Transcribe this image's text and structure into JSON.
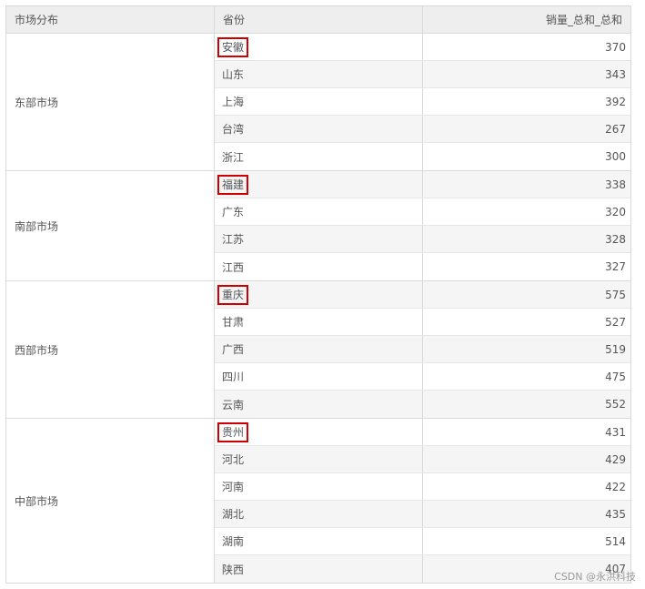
{
  "table": {
    "headers": [
      "市场分布",
      "省份",
      "销量_总和_总和"
    ],
    "groups": [
      {
        "market": "东部市场",
        "rows": [
          {
            "province": "安徽",
            "value": "370",
            "highlighted": true
          },
          {
            "province": "山东",
            "value": "343",
            "highlighted": false
          },
          {
            "province": "上海",
            "value": "392",
            "highlighted": false
          },
          {
            "province": "台湾",
            "value": "267",
            "highlighted": false
          },
          {
            "province": "浙江",
            "value": "300",
            "highlighted": false
          }
        ]
      },
      {
        "market": "南部市场",
        "rows": [
          {
            "province": "福建",
            "value": "338",
            "highlighted": true
          },
          {
            "province": "广东",
            "value": "320",
            "highlighted": false
          },
          {
            "province": "江苏",
            "value": "328",
            "highlighted": false
          },
          {
            "province": "江西",
            "value": "327",
            "highlighted": false
          }
        ]
      },
      {
        "market": "西部市场",
        "rows": [
          {
            "province": "重庆",
            "value": "575",
            "highlighted": true
          },
          {
            "province": "甘肃",
            "value": "527",
            "highlighted": false
          },
          {
            "province": "广西",
            "value": "519",
            "highlighted": false
          },
          {
            "province": "四川",
            "value": "475",
            "highlighted": false
          },
          {
            "province": "云南",
            "value": "552",
            "highlighted": false
          }
        ]
      },
      {
        "market": "中部市场",
        "rows": [
          {
            "province": "贵州",
            "value": "431",
            "highlighted": true
          },
          {
            "province": "河北",
            "value": "429",
            "highlighted": false
          },
          {
            "province": "河南",
            "value": "422",
            "highlighted": false
          },
          {
            "province": "湖北",
            "value": "435",
            "highlighted": false
          },
          {
            "province": "湖南",
            "value": "514",
            "highlighted": false
          },
          {
            "province": "陕西",
            "value": "407",
            "highlighted": false
          }
        ]
      }
    ]
  },
  "colors": {
    "highlight_border": "#d00000",
    "header_bg": "#eeeeee",
    "alt_row_bg": "#f5f5f5"
  },
  "watermark": "CSDN @永洪科技"
}
